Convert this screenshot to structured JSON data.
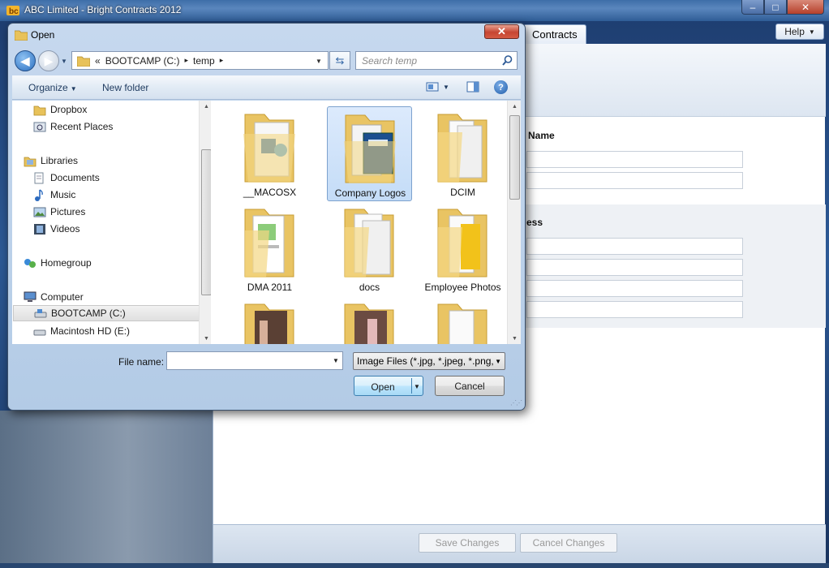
{
  "app": {
    "title": "ABC Limited - Bright Contracts 2012",
    "active_tab": "Contracts",
    "help_label": "Help",
    "window_controls": {
      "minimize": "–",
      "maximize": "□",
      "close": "✕"
    },
    "sections": {
      "name_label": "Name",
      "address_label": "ess"
    },
    "footer": {
      "save_label": "Save Changes",
      "cancel_label": "Cancel Changes"
    }
  },
  "dialog": {
    "title": "Open",
    "close_glyph": "✕",
    "address": {
      "prefix": "«",
      "drive": "BOOTCAMP (C:)",
      "folder": "temp",
      "separator": "▸"
    },
    "search_placeholder": "Search temp",
    "toolbar": {
      "organize": "Organize",
      "new_folder": "New folder",
      "help_glyph": "?"
    },
    "nav": {
      "favorites": [
        "Dropbox",
        "Recent Places"
      ],
      "libraries_header": "Libraries",
      "libraries": [
        "Documents",
        "Music",
        "Pictures",
        "Videos"
      ],
      "homegroup": "Homegroup",
      "computer_header": "Computer",
      "drives": [
        "BOOTCAMP (C:)",
        "Macintosh HD (E:)"
      ],
      "selected": "BOOTCAMP (C:)"
    },
    "files": [
      "__MACOSX",
      "Company Logos",
      "DCIM",
      "DMA 2011",
      "docs",
      "Employee Photos"
    ],
    "selected_file": "Company Logos",
    "file_name_label": "File name:",
    "file_name_value": "",
    "filter": "Image Files (*.jpg, *.jpeg, *.png,",
    "open_label": "Open",
    "cancel_label": "Cancel"
  },
  "colors": {
    "accent": "#3c7fb1",
    "selection": "#c4dcf7",
    "titlebar": "#3e6ea8"
  }
}
